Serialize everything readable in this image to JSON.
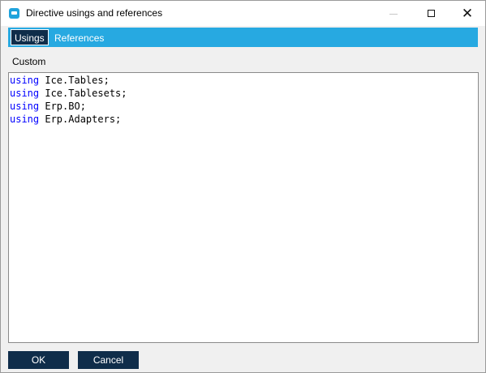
{
  "window": {
    "title": "Directive usings and references",
    "close_glyph": "✕"
  },
  "tabs": [
    {
      "label": "Usings",
      "active": true
    },
    {
      "label": "References",
      "active": false
    }
  ],
  "section": {
    "label": "Custom"
  },
  "editor": {
    "lines": [
      {
        "keyword": "using",
        "text": " Ice.Tables;"
      },
      {
        "keyword": "using",
        "text": " Ice.Tablesets;"
      },
      {
        "keyword": "using",
        "text": " Erp.BO;"
      },
      {
        "keyword": "using",
        "text": " Erp.Adapters;"
      }
    ]
  },
  "buttons": {
    "ok": "OK",
    "cancel": "Cancel"
  },
  "colors": {
    "accent": "#27a9e1",
    "dark_button": "#0f2d4a",
    "keyword": "#0000ff"
  },
  "icons": {
    "app": "app-icon",
    "minimize": "minimize-icon",
    "maximize": "maximize-icon",
    "close": "close-icon"
  }
}
